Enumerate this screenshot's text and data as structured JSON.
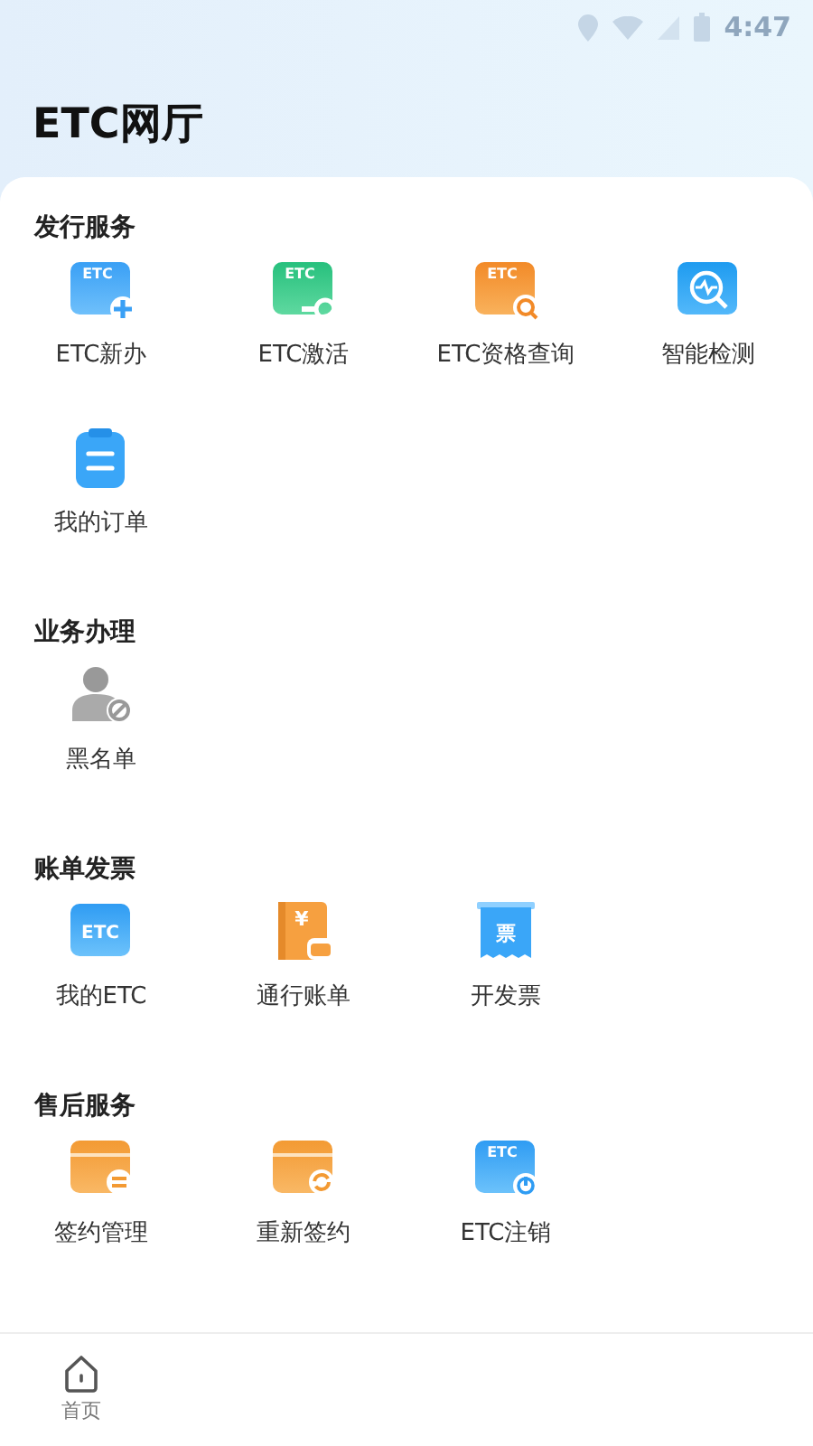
{
  "status_bar": {
    "time": "4:47"
  },
  "header": {
    "title": "ETC网厅"
  },
  "sections": [
    {
      "title": "发行服务",
      "items": [
        {
          "label": "ETC新办",
          "kind": "etc-add",
          "icon_text": "ETC"
        },
        {
          "label": "ETC激活",
          "kind": "etc-key",
          "icon_text": "ETC"
        },
        {
          "label": "ETC资格查询",
          "kind": "etc-search",
          "icon_text": "ETC"
        },
        {
          "label": "智能检测",
          "kind": "detect"
        },
        {
          "label": "我的订单",
          "kind": "clipboard"
        }
      ]
    },
    {
      "title": "业务办理",
      "items": [
        {
          "label": "黑名单",
          "kind": "user-block"
        }
      ]
    },
    {
      "title": "账单发票",
      "items": [
        {
          "label": "我的ETC",
          "kind": "etc-card",
          "icon_text": "ETC"
        },
        {
          "label": "通行账单",
          "kind": "bill",
          "icon_text": "¥"
        },
        {
          "label": "开发票",
          "kind": "ticket",
          "icon_text": "票"
        }
      ]
    },
    {
      "title": "售后服务",
      "items": [
        {
          "label": "签约管理",
          "kind": "card-exchange"
        },
        {
          "label": "重新签约",
          "kind": "card-refresh"
        },
        {
          "label": "ETC注销",
          "kind": "etc-power",
          "icon_text": "ETC"
        }
      ]
    }
  ],
  "bottom_nav": [
    {
      "label": "首页"
    }
  ]
}
